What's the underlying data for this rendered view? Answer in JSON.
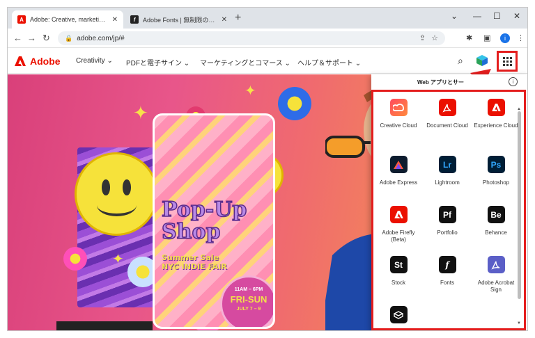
{
  "browser": {
    "tabs": [
      {
        "title": "Adobe: Creative, marketing and",
        "favicon": "adobe-favicon",
        "active": true
      },
      {
        "title": "Adobe Fonts | 無制限のフォントを無",
        "favicon": "adobe-fonts-favicon",
        "active": false
      }
    ],
    "new_tab": "+",
    "window_controls": {
      "chevron": "⌄",
      "minimize": "—",
      "maximize": "☐",
      "close": "✕"
    },
    "url": "adobe.com/jp/#",
    "profile_initial": "i"
  },
  "site": {
    "brand": "Adobe",
    "nav": [
      "Creativity ⌄",
      "PDFと電子サイン ⌄",
      "マーケティングとコマース ⌄",
      "ヘルプ＆サポート ⌄"
    ],
    "brand_color": "#eb1000"
  },
  "hero": {
    "title": "Pop-Up Shop",
    "subtitle1": "Summer Sale",
    "subtitle2": "NYC INDIE FAIR",
    "time": "11AM – 6PM",
    "days": "FRI-SUN",
    "dates": "JULY 7 – 9"
  },
  "apps_panel": {
    "heading": "Web アプリとサー",
    "info_icon": "i",
    "apps": [
      {
        "name": "Creative Cloud",
        "icon": "creative-cloud-icon",
        "glyph": "",
        "color": "#e8304a"
      },
      {
        "name": "Document Cloud",
        "icon": "document-cloud-icon",
        "glyph": "",
        "color": "#eb1000"
      },
      {
        "name": "Experience Cloud",
        "icon": "experience-cloud-icon",
        "glyph": "",
        "color": "#eb1000"
      },
      {
        "name": "Adobe Express",
        "icon": "adobe-express-icon",
        "glyph": "",
        "color": "#0d1c2e"
      },
      {
        "name": "Lightroom",
        "icon": "lightroom-icon",
        "glyph": "Lr",
        "color": "#001e36"
      },
      {
        "name": "Photoshop",
        "icon": "photoshop-icon",
        "glyph": "Ps",
        "color": "#001e36"
      },
      {
        "name": "Adobe Firefly\n(Beta)",
        "icon": "adobe-firefly-icon",
        "glyph": "",
        "color": "#eb1000"
      },
      {
        "name": "Portfolio",
        "icon": "portfolio-icon",
        "glyph": "Pf",
        "color": "#111111"
      },
      {
        "name": "Behance",
        "icon": "behance-icon",
        "glyph": "Be",
        "color": "#111111"
      },
      {
        "name": "Stock",
        "icon": "stock-icon",
        "glyph": "St",
        "color": "#111111"
      },
      {
        "name": "Fonts",
        "icon": "fonts-icon",
        "glyph": "f",
        "color": "#111111"
      },
      {
        "name": "Adobe Acrobat\nSign",
        "icon": "acrobat-sign-icon",
        "glyph": "",
        "color": "#5b5fc7"
      },
      {
        "name": "",
        "icon": "box-icon",
        "glyph": "",
        "color": "#111111"
      }
    ],
    "highlight_color": "#e41e1e"
  }
}
